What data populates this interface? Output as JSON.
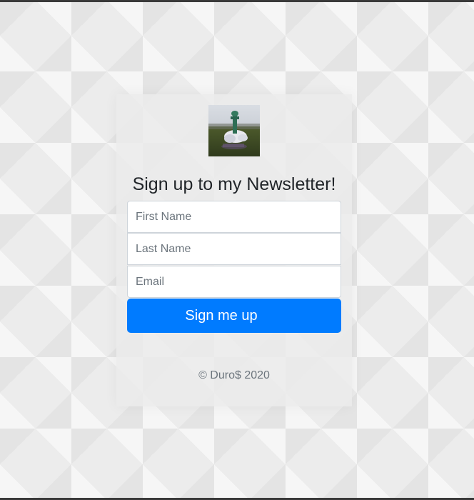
{
  "form": {
    "heading": "Sign up to my Newsletter!",
    "first_name_placeholder": "First Name",
    "last_name_placeholder": "Last Name",
    "email_placeholder": "Email",
    "submit_label": "Sign me up",
    "footer_text": "© Duro$ 2020"
  },
  "colors": {
    "primary": "#007bff",
    "heading_text": "#212529",
    "muted_text": "#6c757d"
  },
  "icons": {
    "logo": "newsletter-logo-photo"
  }
}
